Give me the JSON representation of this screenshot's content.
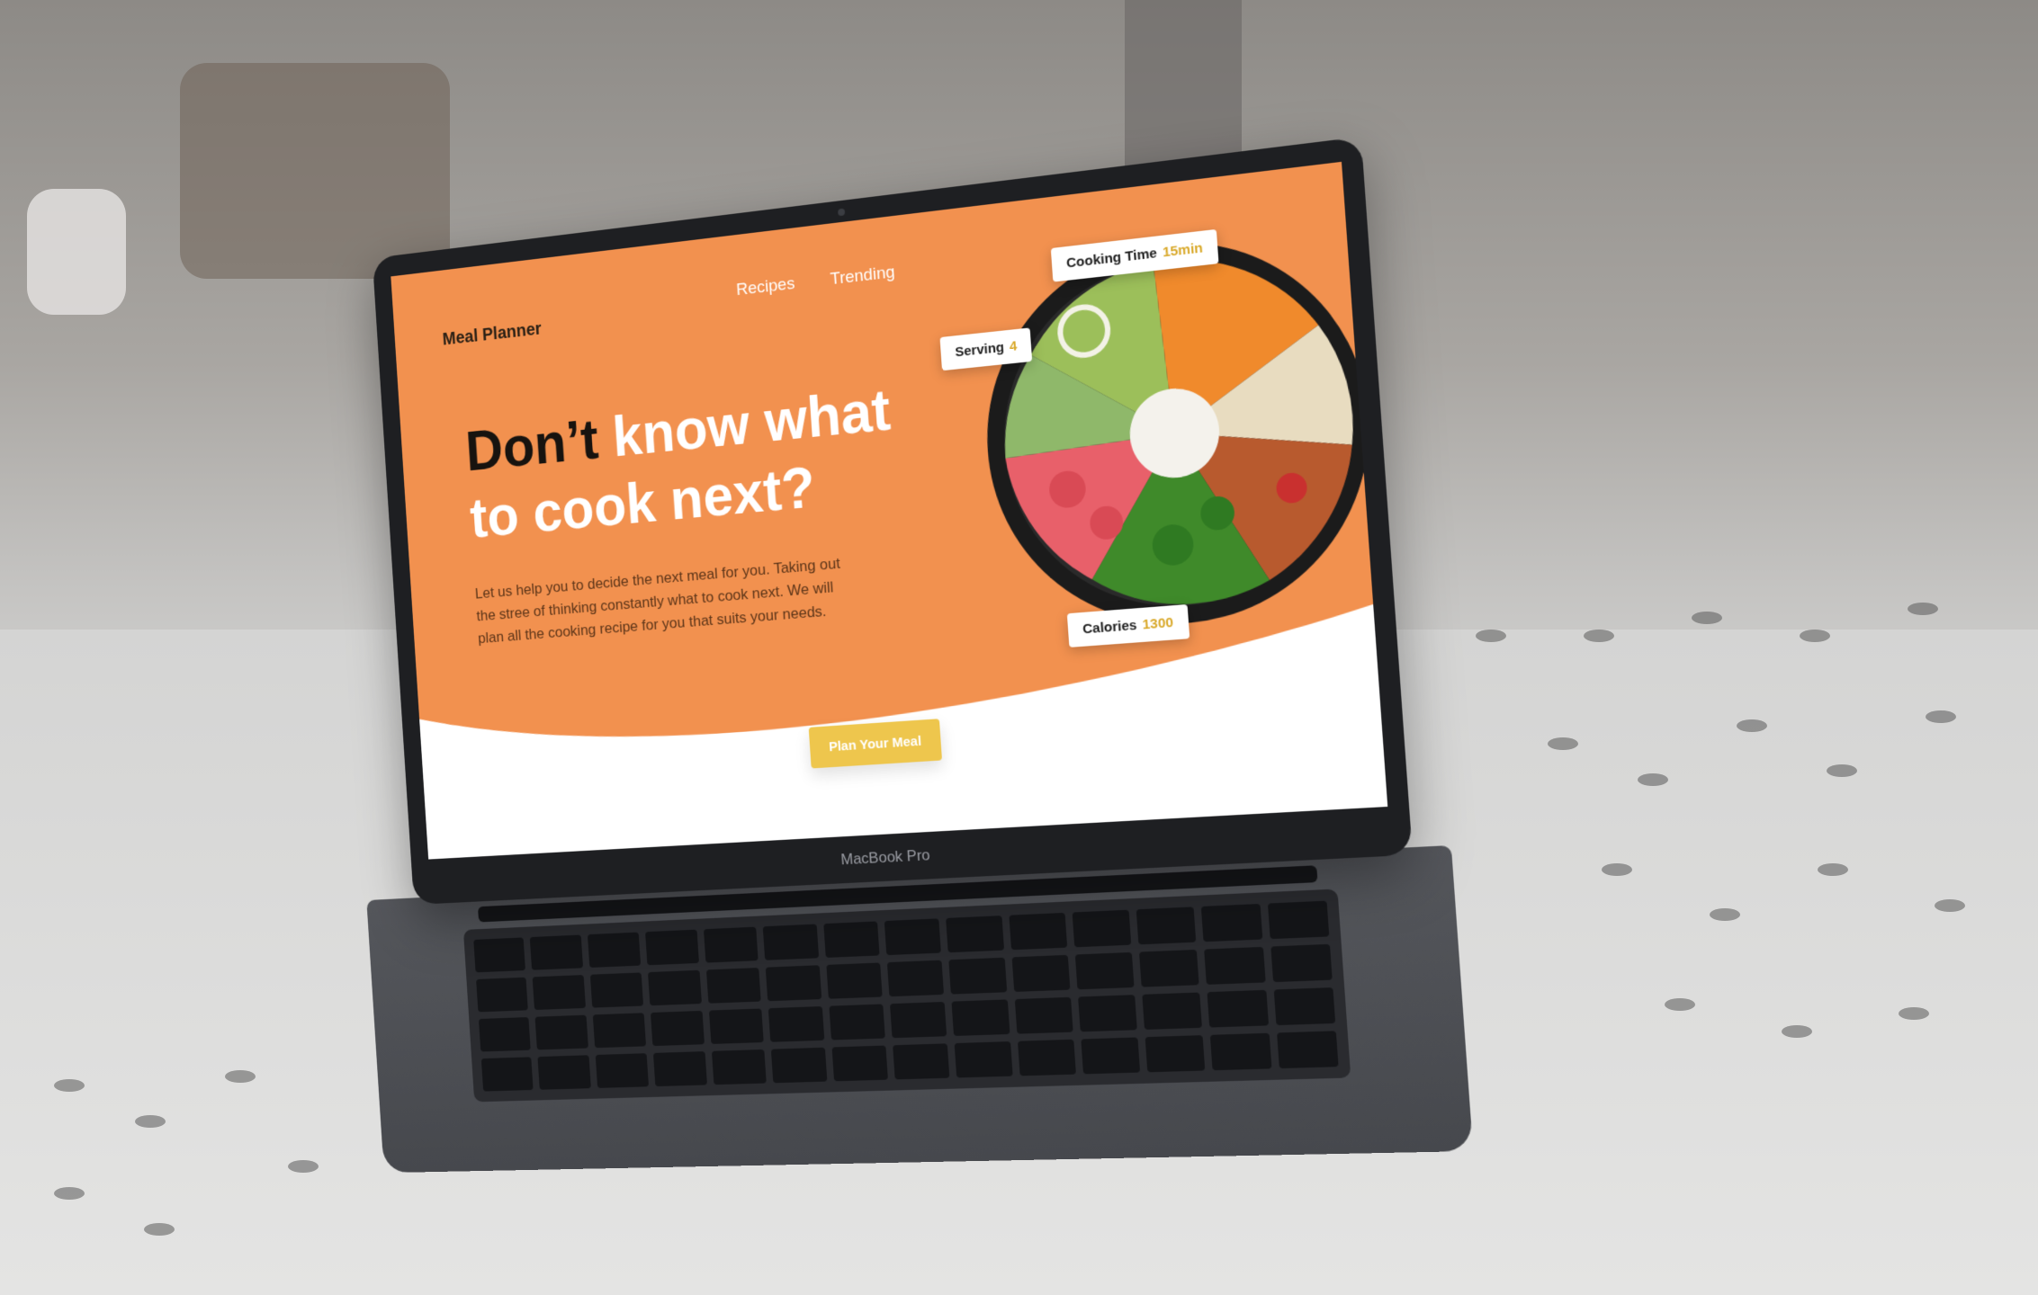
{
  "nav": {
    "logo": "Meal Planner",
    "links": [
      {
        "label": "Recipes"
      },
      {
        "label": "Trending"
      }
    ]
  },
  "hero": {
    "headline_dark": "Don’t",
    "headline_light": " know what to cook next?",
    "description": "Let us help you to decide the next meal for you. Taking out the stree of thinking constantly what to cook next. We will plan all the cooking recipe for you that suits your needs.",
    "cta_label": "Plan Your Meal"
  },
  "meal_stats": {
    "serving": {
      "label": "Serving",
      "value": "4"
    },
    "cooking_time": {
      "label": "Cooking Time",
      "value": "15min"
    },
    "calories": {
      "label": "Calories",
      "value": "1300"
    }
  },
  "device": {
    "brand_label": "MacBook Pro"
  },
  "colors": {
    "hero_orange": "#f2914f",
    "accent_yellow": "#eec64d",
    "stat_value": "#d9a92b",
    "heading_dark": "#17130f"
  }
}
